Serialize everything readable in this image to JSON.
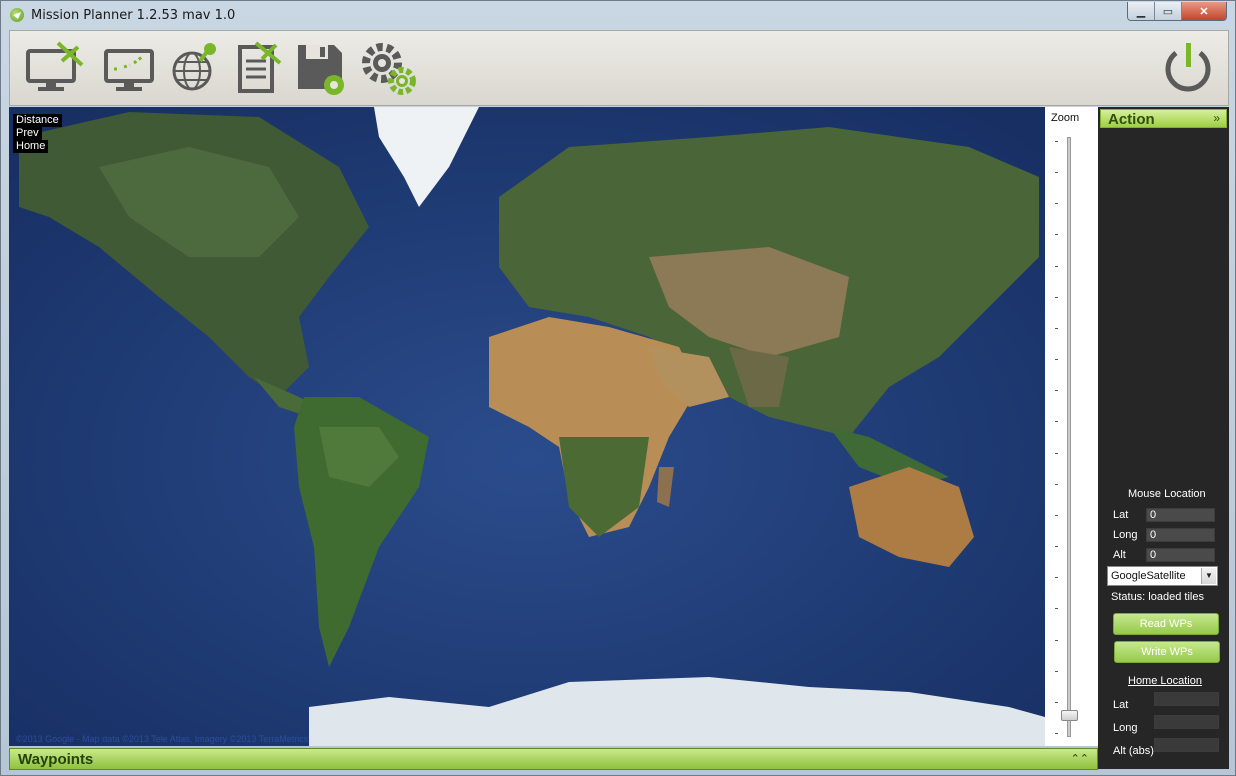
{
  "window": {
    "title": "Mission Planner 1.2.53 mav 1.0"
  },
  "toolbar": {
    "buttons": [
      {
        "icon": "flight-data-icon"
      },
      {
        "icon": "flight-planner-icon"
      },
      {
        "icon": "initial-setup-icon"
      },
      {
        "icon": "config-tuning-icon"
      },
      {
        "icon": "simulation-icon"
      },
      {
        "icon": "terminal-settings-icon"
      }
    ],
    "connect_icon": "power-connect-icon"
  },
  "map": {
    "labels": {
      "distance": "Distance",
      "prev": "Prev",
      "home": "Home"
    },
    "credit": "©2013 Google - Map data ©2013 Tele Atlas, Imagery ©2013 TerraMetrics"
  },
  "zoom": {
    "label": "Zoom",
    "level_fraction": 0.03
  },
  "action": {
    "title": "Action",
    "mouse_location_label": "Mouse Location",
    "lat_label": "Lat",
    "lat_value": "0",
    "long_label": "Long",
    "long_value": "0",
    "alt_label": "Alt",
    "alt_value": "0",
    "map_type": "GoogleSatellite",
    "status": "Status: loaded tiles",
    "read_wps": "Read WPs",
    "write_wps": "Write WPs",
    "home_location_label": "Home Location",
    "home_lat_label": "Lat",
    "home_long_label": "Long",
    "home_alt_label": "Alt (abs)"
  },
  "waypoints": {
    "title": "Waypoints"
  }
}
